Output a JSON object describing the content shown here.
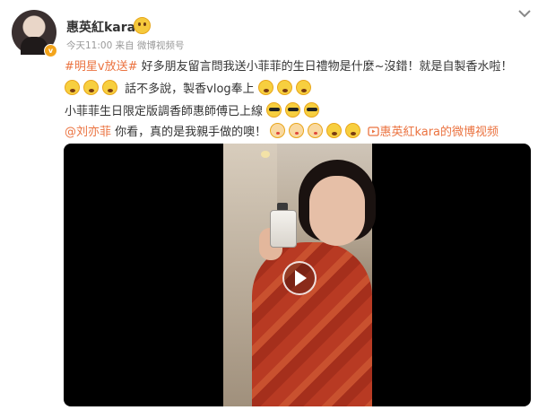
{
  "post": {
    "username": "惠英紅kara",
    "time": "今天11:00",
    "source": "来自 微博视频号",
    "verified_badge": "v",
    "topic": "#明星v放送#",
    "line1_text": " 好多朋友留言問我送小菲菲的生日禮物是什麼~沒錯！就是自製香水啦！",
    "line2_text": "話不多說，製香vlog奉上",
    "line3_text": "小菲菲生日限定版調香師惠師傅已上線",
    "mention": "@刘亦菲",
    "line4_text": " 你看，真的是我親手做的噢！",
    "video_link": "惠英紅kara的微博视频"
  },
  "icons": {
    "menu": "chevron-down-icon",
    "play": "play-icon",
    "emoji_surprised": "surprised-emoji-icon",
    "emoji_grin": "grin-emoji-icon",
    "emoji_cool": "cool-emoji-icon",
    "emoji_kiss": "kiss-emoji-icon",
    "video_link": "video-link-icon"
  },
  "colors": {
    "accent": "#eb7340",
    "verified": "#f3a41b",
    "emoji": "#f7cf3f"
  }
}
